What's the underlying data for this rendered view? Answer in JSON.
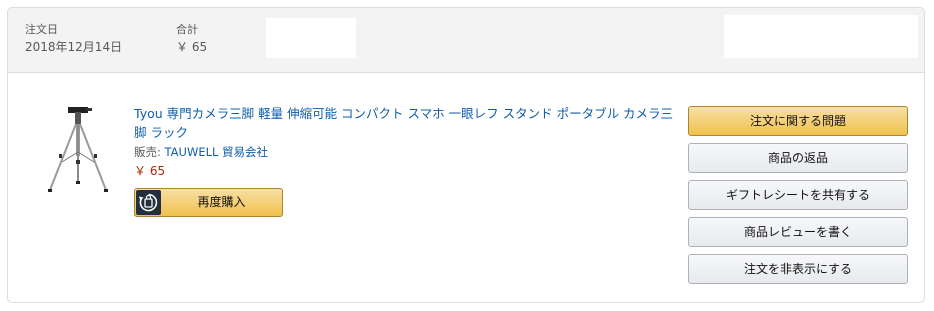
{
  "order_header": {
    "order_date_label": "注文日",
    "order_date_value": "2018年12月14日",
    "total_label": "合計",
    "total_value": "￥ 65"
  },
  "item": {
    "title": "Tyou 専門カメラ三脚 軽量 伸縮可能 コンパクト スマホ 一眼レフ スタンド ポータブル カメラ三脚 ラック",
    "seller_prefix": "販売: ",
    "seller_name": "TAUWELL 貿易会社",
    "price": "￥ 65",
    "rebuy_label": "再度購入",
    "thumbnail_icon": "tripod-product-image",
    "rebuy_icon": "rebuy-icon"
  },
  "actions": [
    {
      "label": "注文に関する問題"
    },
    {
      "label": "商品の返品"
    },
    {
      "label": "ギフトレシートを共有する"
    },
    {
      "label": "商品レビューを書く"
    },
    {
      "label": "注文を非表示にする"
    }
  ],
  "colors": {
    "link": "#0f5dab",
    "price": "#b12704",
    "primary_button": "#f0c14b",
    "header_bg": "#f3f3f3"
  }
}
